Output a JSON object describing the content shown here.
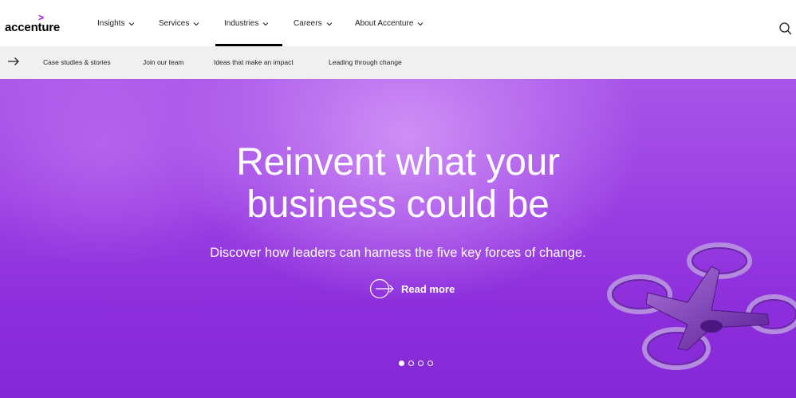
{
  "brand": {
    "name": "accenture",
    "mark": ">"
  },
  "nav": {
    "items": [
      {
        "label": "Insights"
      },
      {
        "label": "Services"
      },
      {
        "label": "Industries"
      },
      {
        "label": "Careers"
      },
      {
        "label": "About Accenture"
      }
    ],
    "active": "Industries"
  },
  "subnav": {
    "items": [
      {
        "label": "Case studies & stories"
      },
      {
        "label": "Join our team"
      },
      {
        "label": "Ideas that make an impact"
      },
      {
        "label": "Leading through change"
      }
    ]
  },
  "hero": {
    "title_line1": "Reinvent what your",
    "title_line2": "business could be",
    "subtitle": "Discover how leaders can harness the five key forces of change.",
    "cta_label": "Read more",
    "slides": 4,
    "active_slide": 1
  },
  "colors": {
    "brand_purple": "#a100ff",
    "hero_purple": "#9a3fe3"
  },
  "icons": [
    "chevron-down-icon",
    "search-icon",
    "arrow-right-icon",
    "circle-arrow-icon"
  ]
}
